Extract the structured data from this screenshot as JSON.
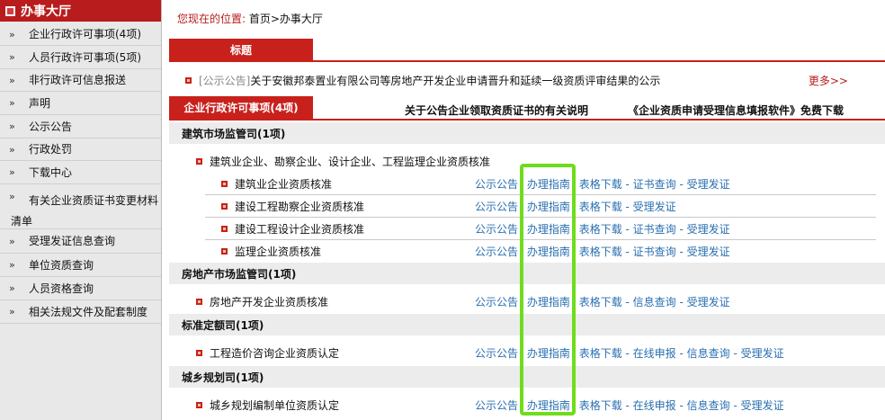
{
  "sidebar": {
    "title": "办事大厅",
    "items": [
      {
        "label": "企业行政许可事项(4项)"
      },
      {
        "label": "人员行政许可事项(5项)"
      },
      {
        "label": "非行政许可信息报送"
      },
      {
        "label": "声明"
      },
      {
        "label": "公示公告"
      },
      {
        "label": "行政处罚"
      },
      {
        "label": "下载中心"
      },
      {
        "label": "有关企业资质证书变更材料清单"
      },
      {
        "label": "受理发证信息查询"
      },
      {
        "label": "单位资质查询"
      },
      {
        "label": "人员资格查询"
      },
      {
        "label": "相关法规文件及配套制度"
      }
    ],
    "chevron": "»"
  },
  "breadcrumb": {
    "label": "您现在的位置:",
    "path": "首页>办事大厅"
  },
  "title_tab": "标题",
  "notice": {
    "tag": "[公示公告]",
    "text": "关于安徽邦泰置业有限公司等房地产开发企业申请晋升和延续一级资质评审结果的公示",
    "more": "更多>>"
  },
  "tabs": {
    "active": "企业行政许可事项(4项)",
    "second": "关于公告企业领取资质证书的有关说明",
    "third": "《企业资质申请受理信息填报软件》免费下载"
  },
  "sections": [
    {
      "title": "建筑市场监管司(1项)"
    },
    {
      "title": "房地产市场监管司(1项)"
    },
    {
      "title": "标准定额司(1项)"
    },
    {
      "title": "城乡规划司(1项)"
    }
  ],
  "subgroup": "建筑业企业、勘察企业、设计企业、工程监理企业资质核准",
  "rows": [
    {
      "name": "建筑业企业资质核准",
      "l1": "公示公告",
      "l2": "办理指南",
      "l3": "表格下载",
      "l4": "证书查询",
      "l5": "受理发证"
    },
    {
      "name": "建设工程勘察企业资质核准",
      "l1": "公示公告",
      "l2": "办理指南",
      "l3": "表格下载",
      "l4": "受理发证"
    },
    {
      "name": "建设工程设计企业资质核准",
      "l1": "公示公告",
      "l2": "办理指南",
      "l3": "表格下载",
      "l4": "证书查询",
      "l5": "受理发证"
    },
    {
      "name": "监理企业资质核准",
      "l1": "公示公告",
      "l2": "办理指南",
      "l3": "表格下载",
      "l4": "证书查询",
      "l5": "受理发证"
    },
    {
      "name": "房地产开发企业资质核准",
      "l1": "公示公告",
      "l2": "办理指南",
      "l3": "表格下载",
      "l4": "信息查询",
      "l5": "受理发证"
    },
    {
      "name": "工程造价咨询企业资质认定",
      "l1": "公示公告",
      "l2": "办理指南",
      "l3": "表格下载",
      "l4": "在线申报",
      "l5": "信息查询",
      "l6": "受理发证"
    },
    {
      "name": "城乡规划编制单位资质认定",
      "l1": "公示公告",
      "l2": "办理指南",
      "l3": "表格下载",
      "l4": "在线申报",
      "l5": "信息查询",
      "l6": "受理发证"
    }
  ],
  "separator": " - ",
  "colors": {
    "red": "#c8211c",
    "link": "#2a6fb0",
    "highlight": "#6fdc1c"
  }
}
